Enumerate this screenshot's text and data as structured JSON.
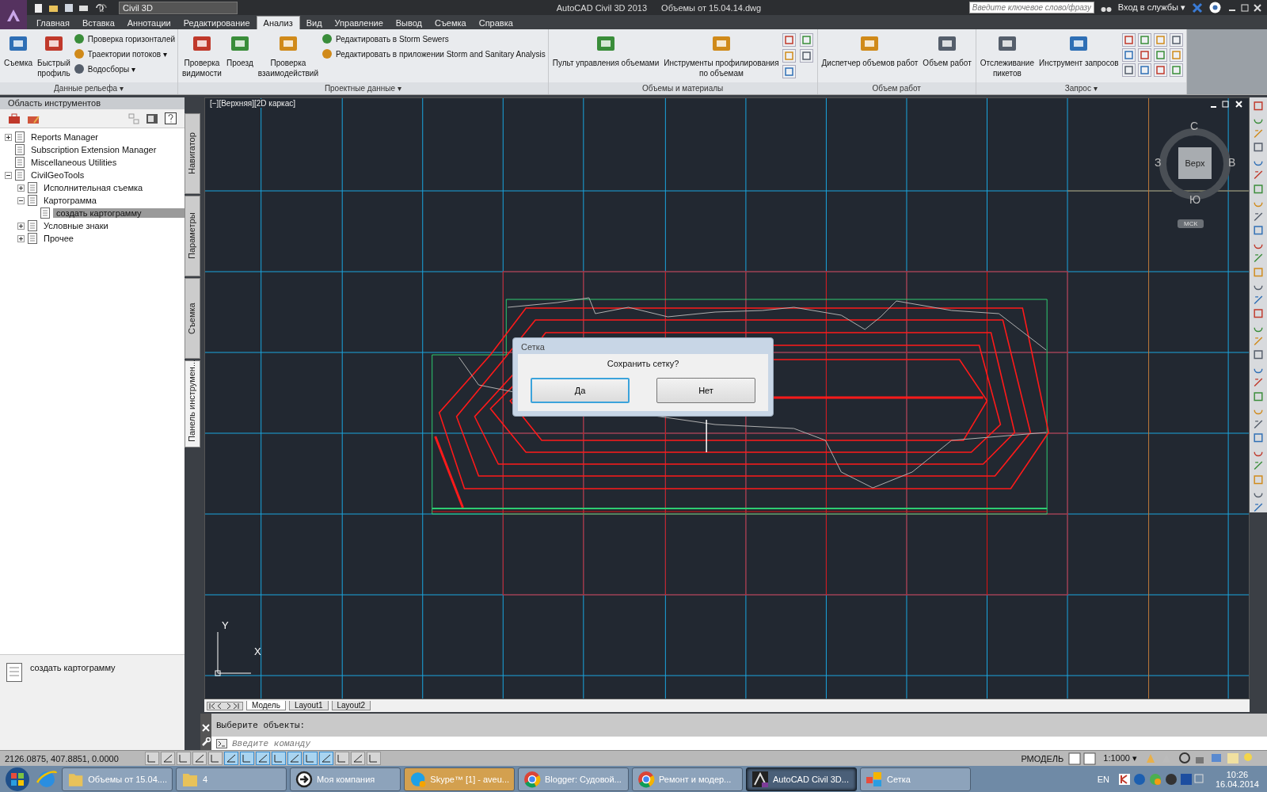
{
  "title_bar": {
    "workspace": "Civil 3D",
    "app": "AutoCAD Civil 3D 2013",
    "file": "Объемы от 15.04.14.dwg",
    "search": {
      "placeholder": "Введите ключевое слово/фразу"
    },
    "sign_in": "Вход в службы ▾"
  },
  "ribbon_tabs": [
    {
      "label": "Главная",
      "selected": false
    },
    {
      "label": "Вставка",
      "selected": false
    },
    {
      "label": "Аннотации",
      "selected": false
    },
    {
      "label": "Редактирование",
      "selected": false
    },
    {
      "label": "Анализ",
      "selected": true
    },
    {
      "label": "Вид",
      "selected": false
    },
    {
      "label": "Управление",
      "selected": false
    },
    {
      "label": "Вывод",
      "selected": false
    },
    {
      "label": "Съемка",
      "selected": false
    },
    {
      "label": "Справка",
      "selected": false
    }
  ],
  "ribbon_panels": [
    {
      "label": "Данные рельефа ▾",
      "large": [
        "Съемка",
        "Быстрый\nпрофиль"
      ],
      "small": [
        "Проверка горизонталей",
        "Траектории потоков ▾",
        "Водосборы ▾"
      ]
    },
    {
      "label": "Проектные данные ▾",
      "large": [
        "Проверка\nвидимости",
        "Проезд",
        "Проверка\nвзаимодействий"
      ],
      "small": [
        "Редактировать в Storm Sewers",
        "Редактировать в приложении Storm and Sanitary Analysis"
      ]
    },
    {
      "label": "Объемы и материалы",
      "large": [
        "Пульт управления объемами",
        "Инструменты профилирования\nпо объемам"
      ]
    },
    {
      "label": "Объем работ",
      "large": [
        "Диспетчер объемов работ",
        "Объем работ"
      ]
    },
    {
      "label": "Запрос ▾",
      "large": [
        "Отслеживание\nпикетов",
        "Инструмент запросов"
      ]
    }
  ],
  "tool_palette": {
    "title": "Область инструментов",
    "tree": [
      {
        "label": "Reports Manager",
        "kind": "folder",
        "expanded": false,
        "selected": false
      },
      {
        "label": "Subscription Extension Manager",
        "kind": "leaf",
        "selected": false
      },
      {
        "label": "Miscellaneous Utilities",
        "kind": "leaf",
        "selected": false
      },
      {
        "label": "CivilGeoTools",
        "kind": "folder",
        "expanded": true,
        "selected": false,
        "children": [
          {
            "label": "Исполнительная съемка",
            "kind": "folder",
            "expanded": false,
            "selected": false
          },
          {
            "label": "Картограмма",
            "kind": "folder",
            "expanded": true,
            "selected": false,
            "children": [
              {
                "label": "создать картограмму",
                "kind": "leaf",
                "selected": true
              }
            ]
          },
          {
            "label": "Условные знаки",
            "kind": "folder",
            "expanded": false,
            "selected": false
          },
          {
            "label": "Прочее",
            "kind": "folder",
            "expanded": false,
            "selected": false
          }
        ]
      }
    ],
    "description": "создать картограмму"
  },
  "side_tabs": [
    {
      "label": "Навигатор",
      "selected": false
    },
    {
      "label": "Параметры",
      "selected": false
    },
    {
      "label": "Съемка",
      "selected": false
    },
    {
      "label": "Панель инструмен...",
      "selected": true
    }
  ],
  "viewport": {
    "label": "[−][Верхняя][2D каркас]",
    "viewcube": {
      "top": "Верх",
      "north": "С",
      "east": "В",
      "south": "Ю",
      "west": "З",
      "ucs": "МСК"
    },
    "axis_x": "X",
    "axis_y": "Y"
  },
  "dialog": {
    "title": "Сетка",
    "message": "Сохранить сетку?",
    "buttons": [
      {
        "label": "Да",
        "selected": true
      },
      {
        "label": "Нет",
        "selected": false
      }
    ]
  },
  "layout_tabs": [
    {
      "label": "Модель",
      "selected": true
    },
    {
      "label": "Layout1",
      "selected": false
    },
    {
      "label": "Layout2",
      "selected": false
    }
  ],
  "command_line": {
    "history": "Выберите объекты:",
    "placeholder": "Введите команду"
  },
  "status_bar": {
    "coordinates": "2126.0875, 407.8851, 0.0000",
    "toggles": [
      {
        "on": false
      },
      {
        "on": false
      },
      {
        "on": false
      },
      {
        "on": false
      },
      {
        "on": false
      },
      {
        "on": true
      },
      {
        "on": true
      },
      {
        "on": true
      },
      {
        "on": true
      },
      {
        "on": true
      },
      {
        "on": true
      },
      {
        "on": true
      },
      {
        "on": false
      },
      {
        "on": false
      },
      {
        "on": false
      }
    ],
    "space": "РМОДЕЛЬ",
    "scale": "1:1000 ▾"
  },
  "taskbar": {
    "items": [
      {
        "label": "Объемы от 15.04....",
        "kind": "folder",
        "selected": false,
        "attention": false
      },
      {
        "label": "4",
        "kind": "folder",
        "selected": false,
        "attention": false
      },
      {
        "label": "Моя компания",
        "kind": "arrow",
        "selected": false,
        "attention": false
      },
      {
        "label": "Skype™ [1] - aveu...",
        "kind": "skype",
        "selected": false,
        "attention": true
      },
      {
        "label": "Blogger: Судовой...",
        "kind": "chrome",
        "selected": false,
        "attention": false
      },
      {
        "label": "Ремонт и модер...",
        "kind": "chrome",
        "selected": false,
        "attention": false
      },
      {
        "label": "AutoCAD Civil 3D...",
        "kind": "autocad",
        "selected": true,
        "attention": false
      },
      {
        "label": "Сетка",
        "kind": "app",
        "selected": false,
        "attention": false
      }
    ],
    "language": "EN",
    "time": "10:26",
    "date": "16.04.2014"
  }
}
